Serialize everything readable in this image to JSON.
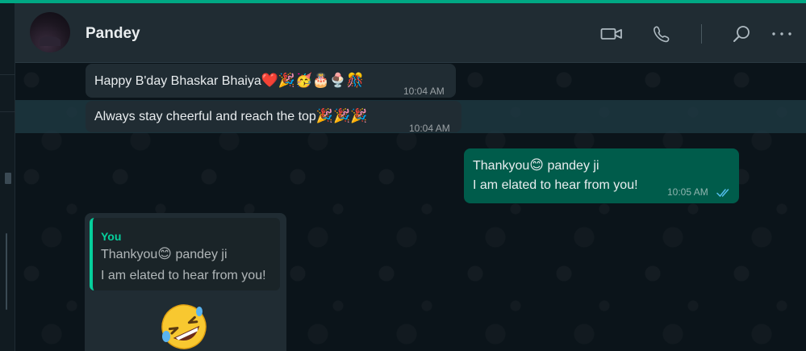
{
  "header": {
    "contact_name": "Pandey",
    "icons": [
      "video-call-icon",
      "voice-call-icon",
      "search-icon",
      "more-options-icon"
    ]
  },
  "messages": [
    {
      "direction": "incoming",
      "text": "Happy B'day Bhaskar Bhaiya",
      "emoji": "❤️🎉🥳🎂🍨🎊",
      "time": "10:04 AM"
    },
    {
      "direction": "incoming",
      "text": "Always stay cheerful and reach the top",
      "emoji": "🎉🎉🎉",
      "time": "10:04 AM",
      "highlighted": true
    },
    {
      "direction": "outgoing",
      "line1_before": "Thankyou",
      "line1_emoji": "😊",
      "line1_after": " pandey ji",
      "line2": "I am elated to hear from you!",
      "time": "10:05 AM",
      "status": "read"
    },
    {
      "direction": "incoming",
      "quote": {
        "author": "You",
        "line1_before": "Thankyou",
        "line1_emoji": "😊",
        "line1_after": " pandey ji",
        "line2": "I am elated to hear from you!"
      },
      "sticker": "rolling-laughing-emoji-sticker"
    }
  ],
  "colors": {
    "accent": "#00a884",
    "incoming_bubble": "#202c33",
    "outgoing_bubble": "#005c4b",
    "quote_author": "#06cf9c",
    "read_ticks": "#53bdeb"
  }
}
